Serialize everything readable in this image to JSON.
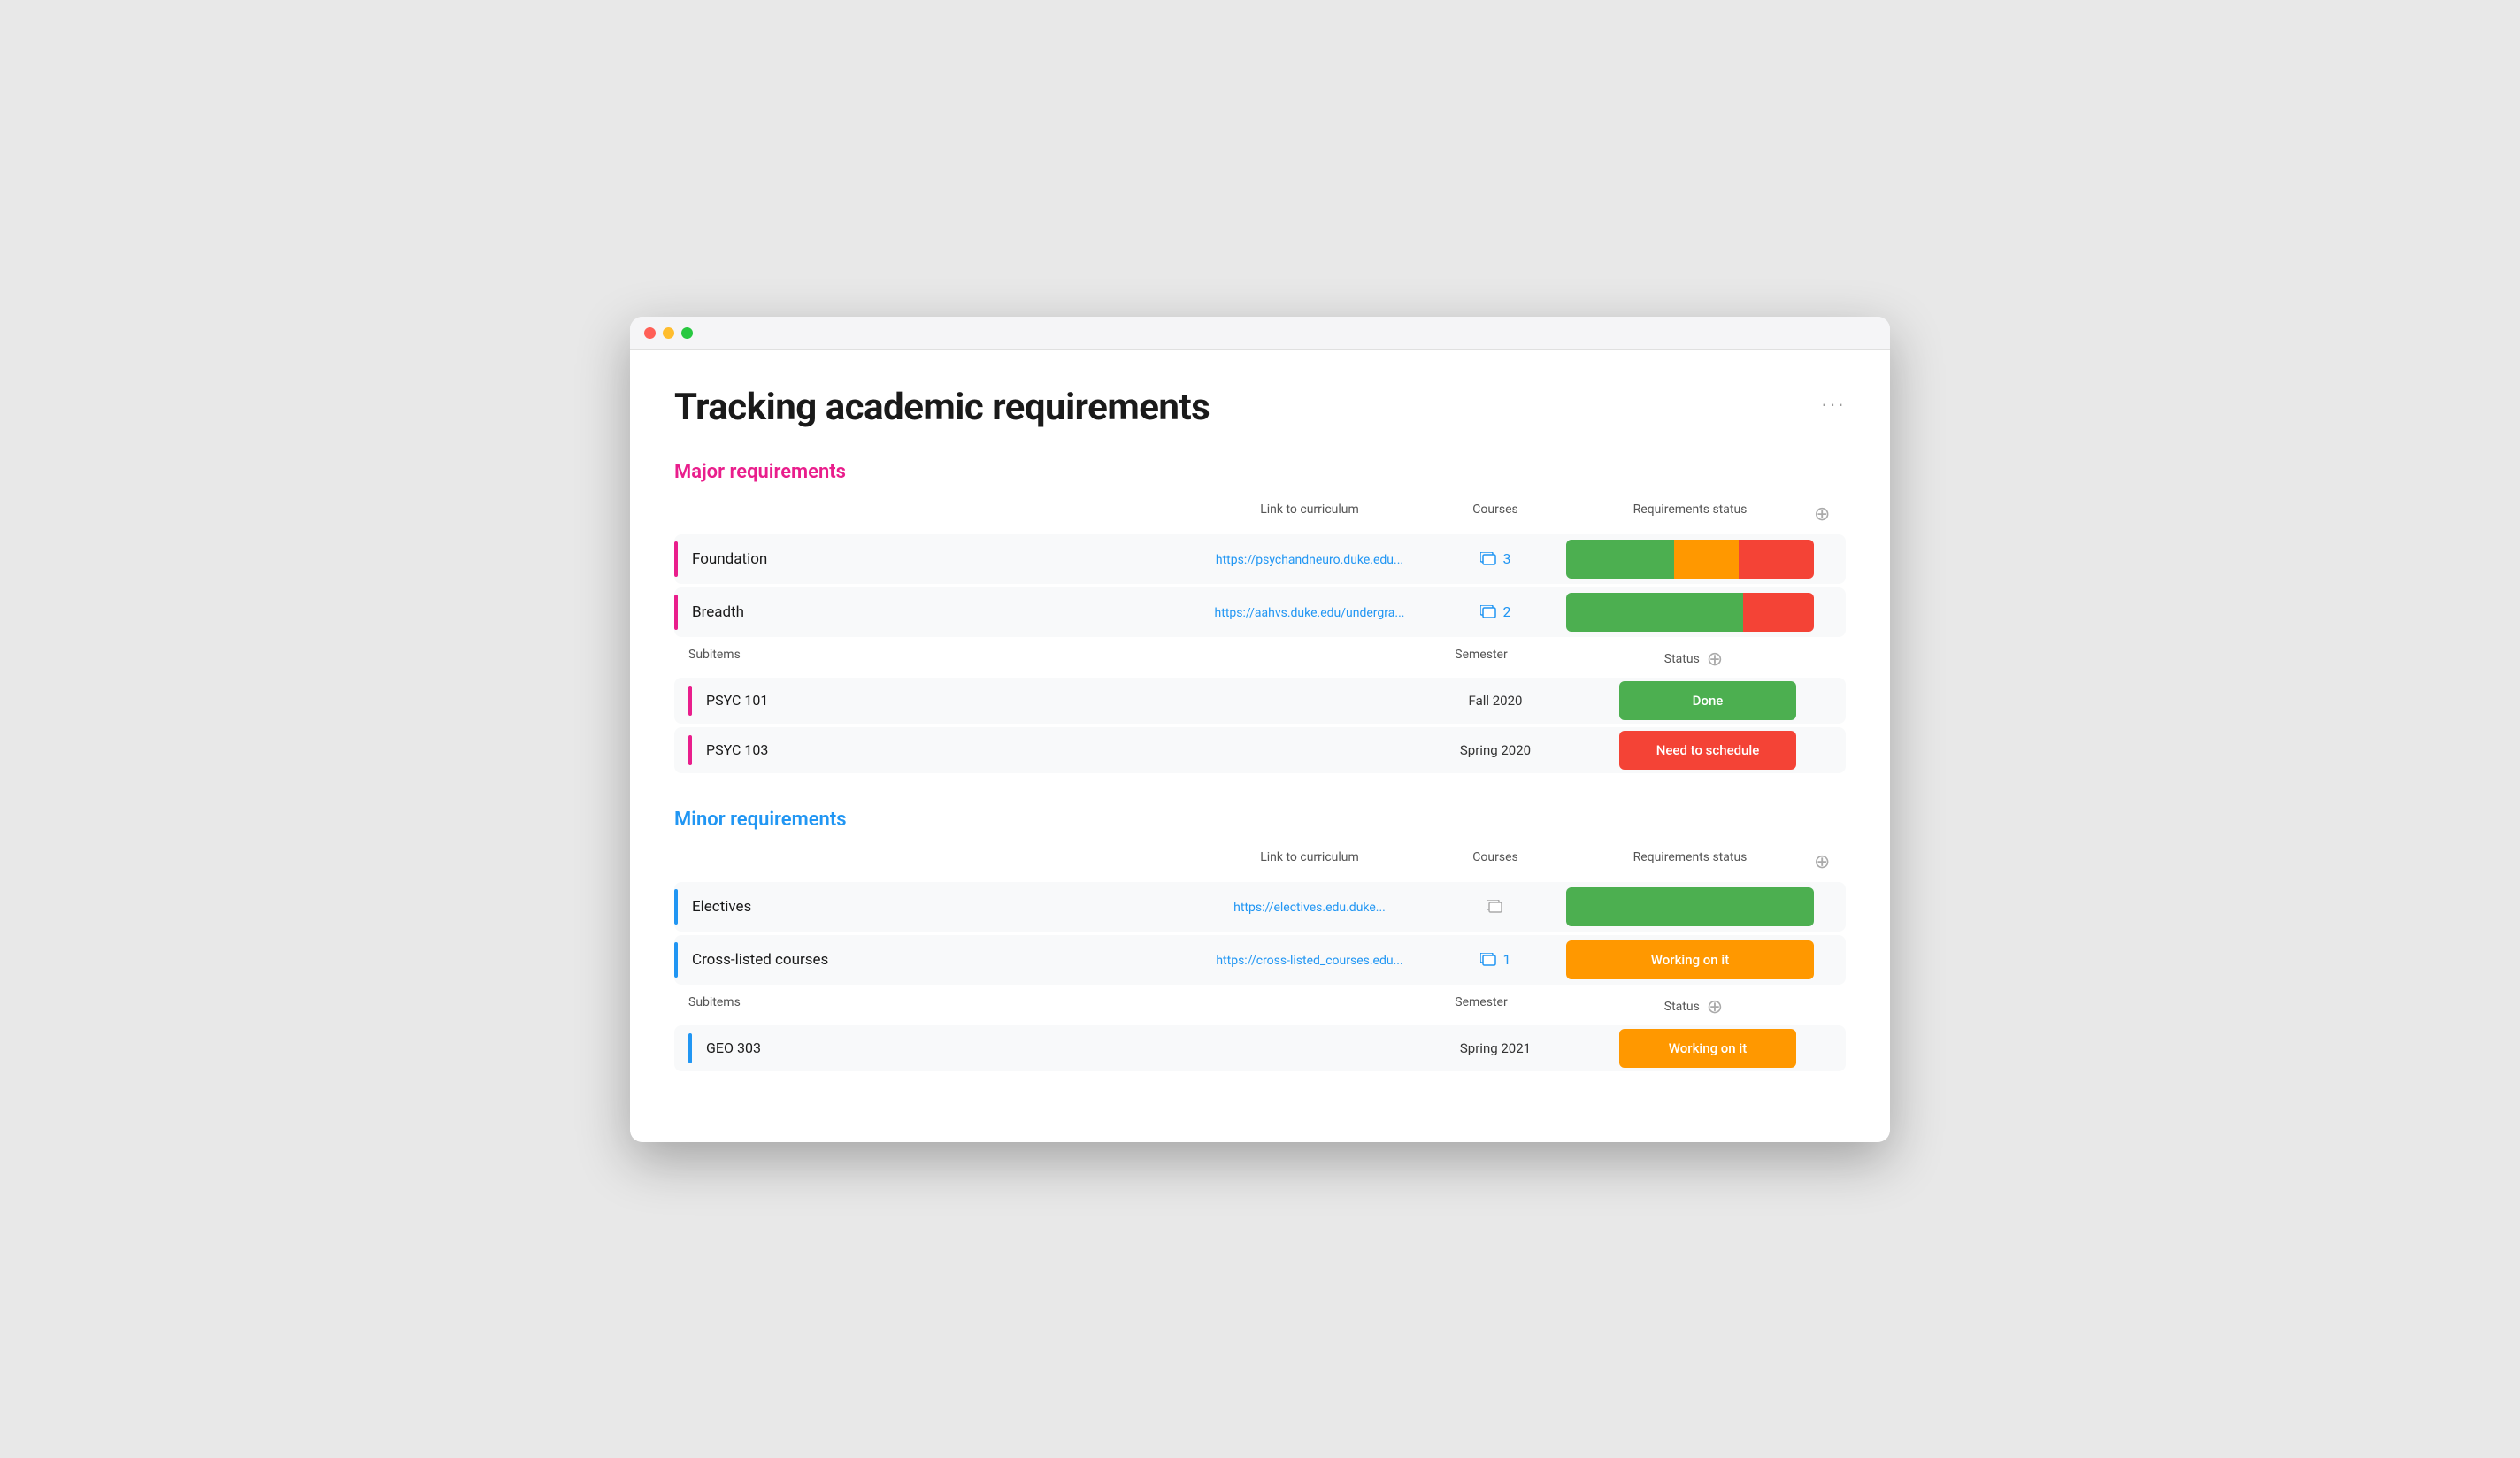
{
  "page": {
    "title": "Tracking academic requirements",
    "more_label": "···"
  },
  "major_section": {
    "title": "Major requirements",
    "link_col": "Link to curriculum",
    "courses_col": "Courses",
    "status_col": "Requirements status",
    "rows": [
      {
        "name": "Foundation",
        "link": "https://psychandneuro.duke.edu...",
        "courses_count": "3",
        "accent": "pink"
      },
      {
        "name": "Breadth",
        "link": "https://aahvs.duke.edu/undergra...",
        "courses_count": "2",
        "accent": "pink"
      }
    ],
    "subitems_label": "Subitems",
    "semester_label": "Semester",
    "status_label": "Status",
    "subitems": [
      {
        "name": "PSYC 101",
        "semester": "Fall 2020",
        "status": "Done",
        "status_type": "green",
        "accent": "pink"
      },
      {
        "name": "PSYC 103",
        "semester": "Spring 2020",
        "status": "Need to schedule",
        "status_type": "red",
        "accent": "pink"
      }
    ]
  },
  "minor_section": {
    "title": "Minor requirements",
    "link_col": "Link to curriculum",
    "courses_col": "Courses",
    "status_col": "Requirements status",
    "rows": [
      {
        "name": "Electives",
        "link": "https://electives.edu.duke...",
        "courses_count": "",
        "accent": "blue"
      },
      {
        "name": "Cross-listed courses",
        "link": "https://cross-listed_courses.edu...",
        "courses_count": "1",
        "accent": "blue"
      }
    ],
    "subitems_label": "Subitems",
    "semester_label": "Semester",
    "status_label": "Status",
    "subitems": [
      {
        "name": "GEO 303",
        "semester": "Spring 2021",
        "status": "Working on it",
        "status_type": "orange",
        "accent": "blue"
      }
    ]
  },
  "icons": {
    "courses": "⊞",
    "add": "⊕",
    "more": "···"
  }
}
